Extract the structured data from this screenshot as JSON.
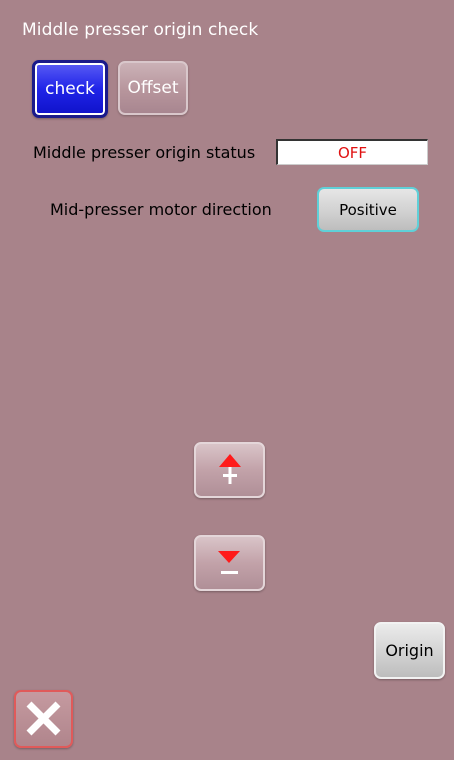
{
  "header": {
    "title": "Middle presser origin check"
  },
  "tabs": [
    {
      "label": "check",
      "selected": true
    },
    {
      "label": "Offset",
      "selected": false
    }
  ],
  "status": {
    "label": "Middle presser origin status",
    "value": "OFF",
    "value_color": "#e01010"
  },
  "direction": {
    "label": "Mid-presser motor direction",
    "button_label": "Positive"
  },
  "controls": {
    "increase_icon": "plus-up-arrow-icon",
    "decrease_icon": "minus-down-arrow-icon",
    "origin_label": "Origin",
    "close_icon": "close-icon"
  },
  "colors": {
    "background": "#a8838a",
    "selected_tab": "#2024e8",
    "accent_red": "#ff0000"
  }
}
